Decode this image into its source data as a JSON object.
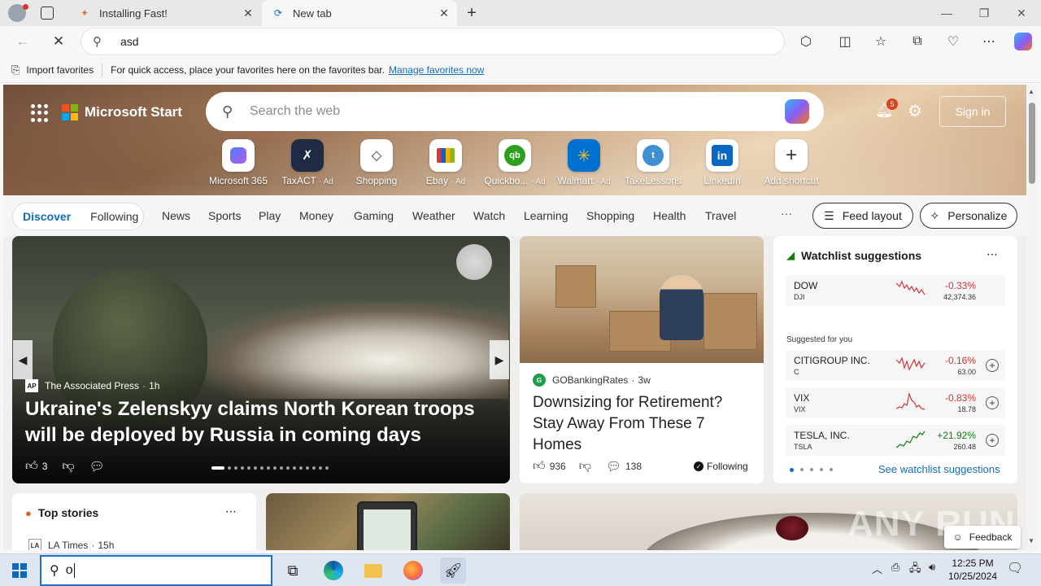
{
  "browser": {
    "tabs": [
      {
        "title": "Installing Fast!",
        "active": false
      },
      {
        "title": "New tab",
        "active": true
      }
    ],
    "address": {
      "value": "asd"
    },
    "favorites_bar": {
      "import_label": "Import favorites",
      "hint": "For quick access, place your favorites here on the favorites bar.",
      "manage_link": "Manage favorites now"
    }
  },
  "header": {
    "brand": "Microsoft Start",
    "search_placeholder": "Search the web",
    "notifications_count": "5",
    "signin_label": "Sign in"
  },
  "shortcuts": [
    {
      "label": "Microsoft 365",
      "ad": "",
      "icon": "m365-icon"
    },
    {
      "label": "TaxACT",
      "ad": "· Ad",
      "icon": "taxact-icon"
    },
    {
      "label": "Shopping",
      "ad": "",
      "icon": "shopping-tag-icon"
    },
    {
      "label": "Ebay",
      "ad": "· Ad",
      "icon": "ebay-icon"
    },
    {
      "label": "Quickbo...",
      "ad": "· Ad",
      "icon": "quickbooks-icon"
    },
    {
      "label": "Walmart",
      "ad": "· Ad",
      "icon": "walmart-icon"
    },
    {
      "label": "TakeLessons",
      "ad": "",
      "icon": "takelessons-icon"
    },
    {
      "label": "LinkedIn",
      "ad": "",
      "icon": "linkedin-icon"
    },
    {
      "label": "Add shortcut",
      "ad": "",
      "icon": "plus-icon"
    }
  ],
  "nav": {
    "discover": "Discover",
    "following": "Following",
    "categories": [
      "News",
      "Sports",
      "Play",
      "Money",
      "Gaming",
      "Weather",
      "Watch",
      "Learning",
      "Shopping",
      "Health",
      "Travel"
    ],
    "more": "···",
    "feed_layout": "Feed layout",
    "personalize": "Personalize"
  },
  "main_story": {
    "source": "The Associated Press",
    "age": "1h",
    "title": "Ukraine's Zelenskyy claims North Korean troops will be deployed by Russia in coming days",
    "likes": "3"
  },
  "second_story": {
    "source": "GOBankingRates",
    "age": "3w",
    "title": "Downsizing for Retirement? Stay Away From These 7 Homes",
    "likes": "936",
    "comments": "138",
    "following": "Following"
  },
  "watchlist": {
    "title": "Watchlist suggestions",
    "suggested_label": "Suggested for you",
    "see_more": "See watchlist suggestions",
    "items": [
      {
        "name": "DOW",
        "symbol": "DJI",
        "change": "-0.33%",
        "price": "42,374.36",
        "trend": "down"
      },
      {
        "name": "CITIGROUP INC.",
        "symbol": "C",
        "change": "-0.16%",
        "price": "63.00",
        "trend": "down"
      },
      {
        "name": "VIX",
        "symbol": "VIX",
        "change": "-0.83%",
        "price": "18.78",
        "trend": "down"
      },
      {
        "name": "TESLA, INC.",
        "symbol": "TSLA",
        "change": "+21.92%",
        "price": "260.48",
        "trend": "up"
      }
    ],
    "colors": {
      "down": "#d13438",
      "up": "#107c10"
    }
  },
  "top_stories": {
    "title": "Top stories",
    "source": "LA Times",
    "age": "15h"
  },
  "feedback": "Feedback",
  "watermark": "ANY RUN",
  "taskbar": {
    "search_value": "o",
    "time": "12:25 PM",
    "date": "10/25/2024"
  }
}
